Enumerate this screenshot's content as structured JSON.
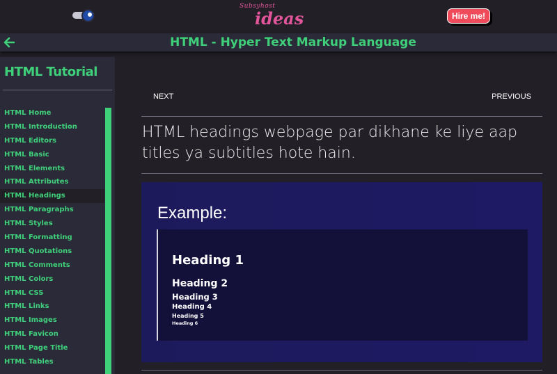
{
  "header": {
    "logo_small": "Subsyhost",
    "logo_big": "ideas",
    "hire_label": "Hire me!",
    "theme_toggle": "dark"
  },
  "titlebar": {
    "title": "HTML - Hyper Text Markup Language",
    "back_icon": "arrow-left-icon"
  },
  "sidebar": {
    "heading": "HTML Tutorial",
    "active_index": 6,
    "items": [
      "HTML Home",
      "HTML Introduction",
      "HTML Editors",
      "HTML Basic",
      "HTML Elements",
      "HTML Attributes",
      "HTML Headings",
      "HTML Paragraphs",
      "HTML Styles",
      "HTML Formatting",
      "HTML Quotations",
      "HTML Comments",
      "HTML Colors",
      "HTML CSS",
      "HTML Links",
      "HTML Images",
      "HTML Favicon",
      "HTML Page Title",
      "HTML Tables"
    ]
  },
  "main": {
    "next_label": "NEXT",
    "previous_label": "PREVIOUS",
    "intro": "HTML headings webpage par dikhane ke liye aap titles ya subtitles hote hain.",
    "example": {
      "title": "Example:",
      "headings": [
        "Heading 1",
        "Heading 2",
        "Heading 3",
        "Heading 4",
        "Heading 5",
        "Heading 6"
      ]
    }
  },
  "colors": {
    "accent": "#3fd17a",
    "background": "#221f26",
    "panel": "#2b2a39",
    "hire": "#ef4b5b",
    "logo": "#e2559a",
    "example_bg": "#1d1a5c"
  }
}
